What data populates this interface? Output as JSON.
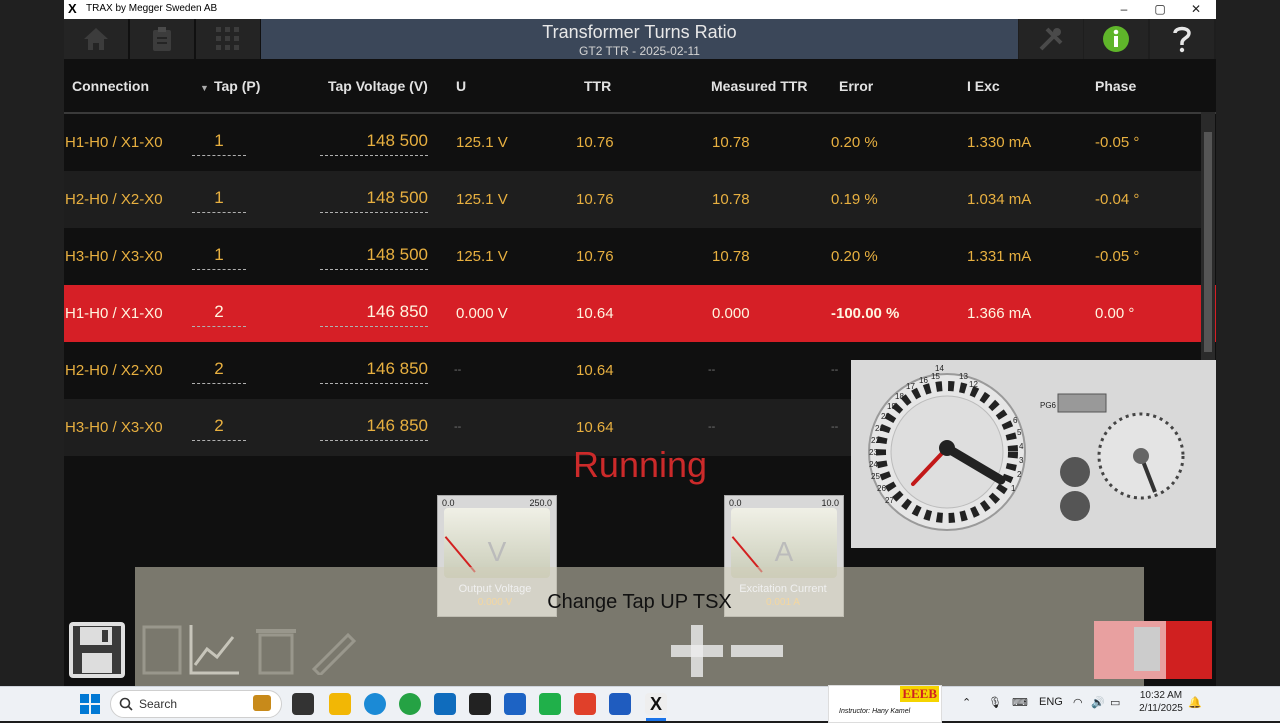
{
  "window": {
    "title": "TRAX by Megger Sweden AB",
    "logo": "X",
    "controls": [
      "–",
      "▢",
      "✕"
    ]
  },
  "header": {
    "title": "Transformer Turns Ratio",
    "subtitle": "GT2 TTR - 2025-02-11"
  },
  "columns": {
    "connection": "Connection",
    "tap": "Tap (P)",
    "tap_voltage": "Tap Voltage (V)",
    "u": "U",
    "ttr": "TTR",
    "measured_ttr": "Measured TTR",
    "error": "Error",
    "i_exc": "I Exc",
    "phase": "Phase"
  },
  "rows": [
    {
      "connection": "H1-H0 / X1-X0",
      "tap": "1",
      "tap_voltage": "148 500",
      "u": "125.1 V",
      "ttr": "10.76",
      "measured_ttr": "10.78",
      "error": "0.20 %",
      "i_exc": "1.330 mA",
      "phase": "-0.05 °"
    },
    {
      "connection": "H2-H0 / X2-X0",
      "tap": "1",
      "tap_voltage": "148 500",
      "u": "125.1 V",
      "ttr": "10.76",
      "measured_ttr": "10.78",
      "error": "0.19 %",
      "i_exc": "1.034 mA",
      "phase": "-0.04 °"
    },
    {
      "connection": "H3-H0 / X3-X0",
      "tap": "1",
      "tap_voltage": "148 500",
      "u": "125.1 V",
      "ttr": "10.76",
      "measured_ttr": "10.78",
      "error": "0.20 %",
      "i_exc": "1.331 mA",
      "phase": "-0.05 °"
    },
    {
      "connection": "H1-H0 / X1-X0",
      "tap": "2",
      "tap_voltage": "146 850",
      "u": "0.000 V",
      "ttr": "10.64",
      "measured_ttr": "0.000",
      "error": "-100.00 %",
      "i_exc": "1.366 mA",
      "phase": "0.00 °"
    },
    {
      "connection": "H2-H0 / X2-X0",
      "tap": "2",
      "tap_voltage": "146 850",
      "u": "--",
      "ttr": "10.64",
      "measured_ttr": "--",
      "error": "--",
      "i_exc": "",
      "phase": ""
    },
    {
      "connection": "H3-H0 / X3-X0",
      "tap": "2",
      "tap_voltage": "146 850",
      "u": "--",
      "ttr": "10.64",
      "measured_ttr": "--",
      "error": "--",
      "i_exc": "",
      "phase": ""
    }
  ],
  "status": "Running",
  "meters": {
    "voltage": {
      "min": "0.0",
      "max": "250.0",
      "unit": "V",
      "label": "Output Voltage",
      "value": "0.000 V",
      "needle_fraction": 0.0
    },
    "current": {
      "min": "0.0",
      "max": "10.0",
      "unit": "A",
      "label": "Excitation Current",
      "value": "0.001 A",
      "needle_fraction": 0.0
    }
  },
  "overlay_message": "Change Tap UP TSX",
  "camera": {
    "usb_label": "PG6",
    "dial_numbers": [
      "14",
      "13",
      "12",
      "15",
      "16",
      "17",
      "18",
      "19",
      "20",
      "21",
      "22",
      "23",
      "24",
      "25",
      "26",
      "27",
      "1",
      "2",
      "3",
      "4",
      "5",
      "6"
    ]
  },
  "taskbar": {
    "search_placeholder": "Search",
    "language": "ENG",
    "time": "10:32 AM",
    "date": "2/11/2025",
    "instructor_logo": "EEEB",
    "instructor": "Instructor: Hany Kamel"
  },
  "colors": {
    "highlight_row": "#d61f26",
    "value_text": "#e8b040",
    "title_box": "#3b4759",
    "status_running": "#cc2a2a"
  }
}
